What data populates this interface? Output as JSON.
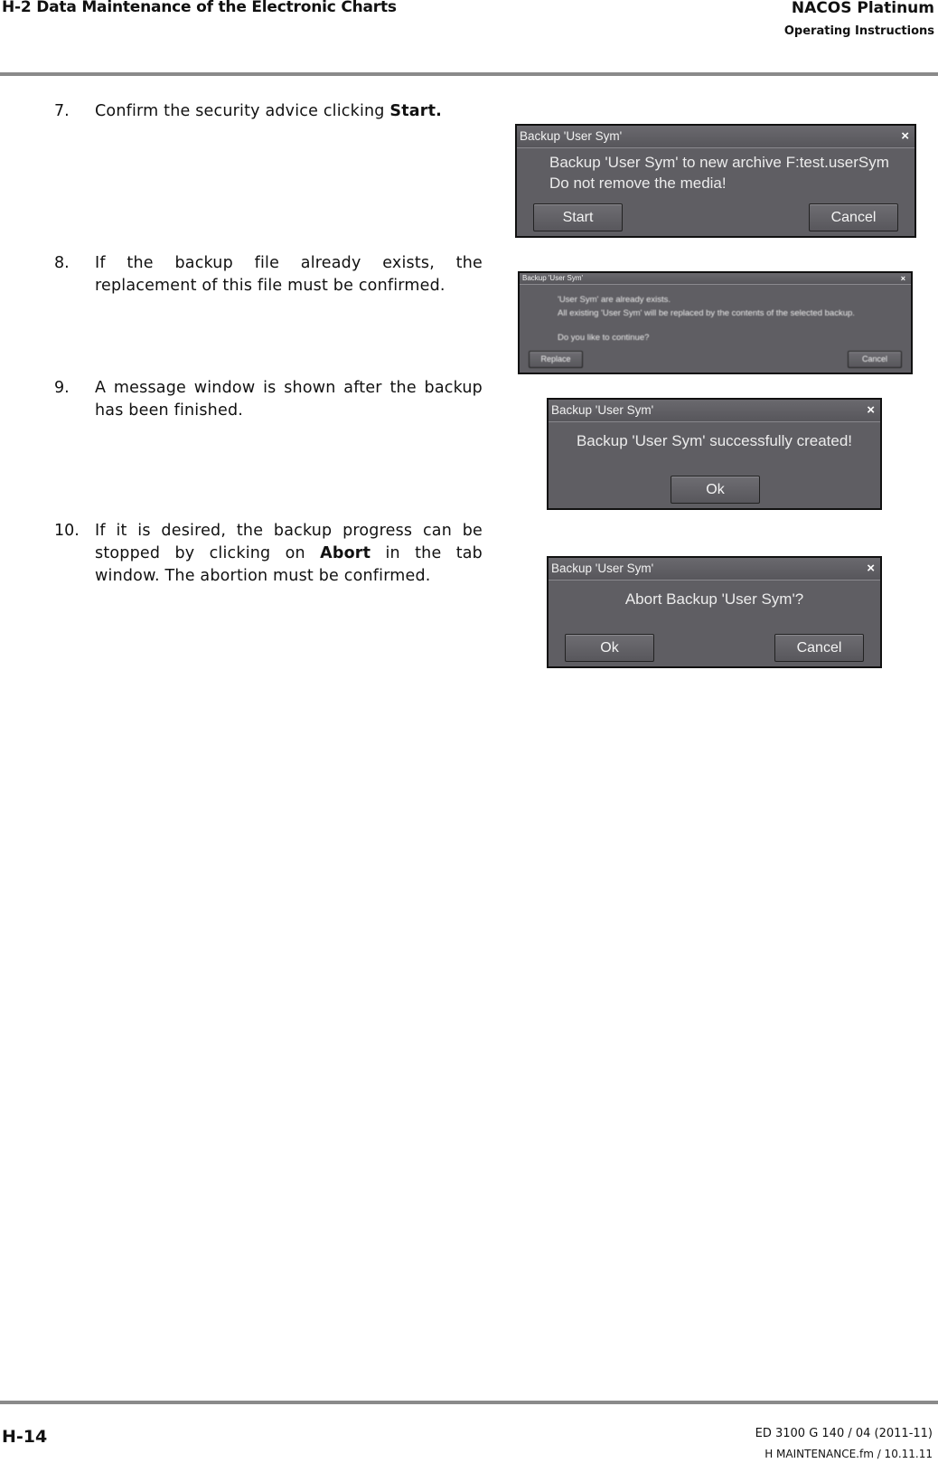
{
  "header": {
    "section": "H-2  Data Maintenance of the Electronic Charts",
    "product": "NACOS Platinum",
    "doc_type": "Operating Instructions"
  },
  "steps": [
    {
      "num": "7.",
      "text_before": "Confirm the security advice clicking ",
      "bold": "Start.",
      "text_after": ""
    },
    {
      "num": "8.",
      "text_before": "If the backup file already exists, the replacement of this file must be confirmed.",
      "bold": "",
      "text_after": ""
    },
    {
      "num": "9.",
      "text_before": "A message window is shown after the backup has been finished.",
      "bold": "",
      "text_after": ""
    },
    {
      "num": "10.",
      "text_before": "If it is desired, the backup progress can be stopped by clicking on ",
      "bold": "Abort",
      "text_after": " in the tab window. The abortion must be confirmed."
    }
  ],
  "dialogs": {
    "start": {
      "title": "Backup 'User Sym'",
      "close": "×",
      "line1": "Backup 'User Sym' to new archive F:test.userSym",
      "line2": "Do not remove the media!",
      "ok_label": "Start",
      "cancel_label": "Cancel"
    },
    "replace": {
      "title": "Backup 'User Sym'",
      "close": "×",
      "line1": "'User Sym' are already exists.",
      "line2": "All existing 'User Sym' will be replaced by the contents of the selected backup.",
      "line3": "Do you like to continue?",
      "ok_label": "Replace",
      "cancel_label": "Cancel"
    },
    "success": {
      "title": "Backup 'User Sym'",
      "close": "×",
      "line1": "Backup 'User Sym' successfully created!",
      "ok_label": "Ok"
    },
    "abort": {
      "title": "Backup 'User Sym'",
      "close": "×",
      "line1": "Abort Backup 'User Sym'?",
      "ok_label": "Ok",
      "cancel_label": "Cancel"
    }
  },
  "footer": {
    "page": "H-14",
    "edition": "ED 3100 G 140 / 04 (2011-11)",
    "file": "H MAINTENANCE.fm / 10.11.11"
  }
}
